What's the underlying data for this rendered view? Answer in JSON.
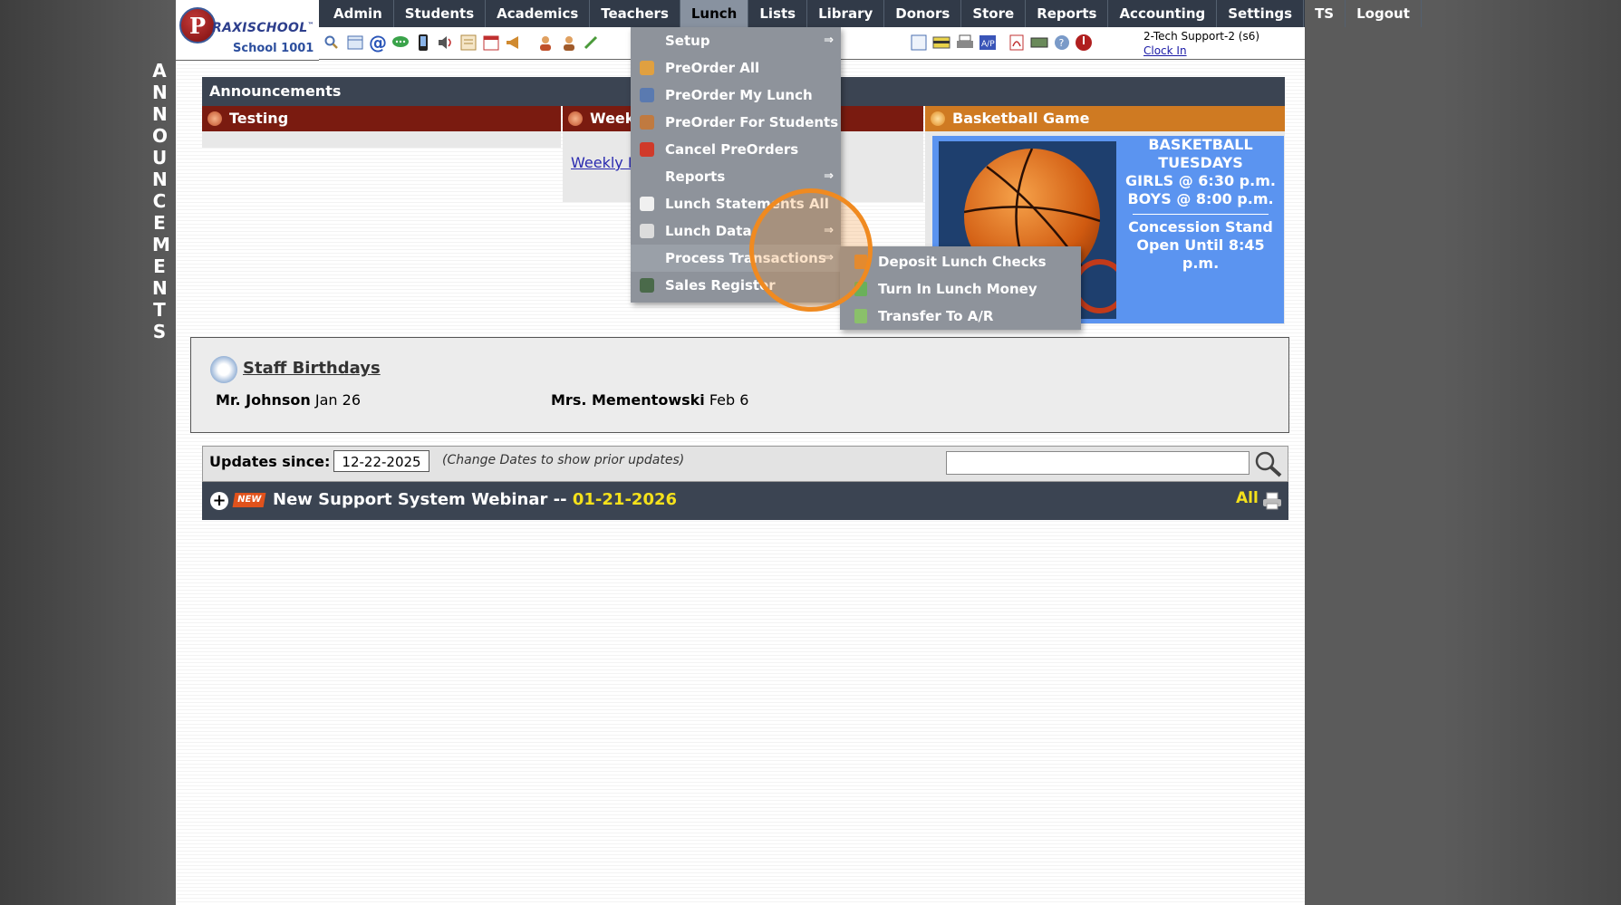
{
  "logo": {
    "initial": "P",
    "brand_line1": "RAXI",
    "brand_line2": "SCHOOL",
    "school": "School 1001",
    "tm": "™"
  },
  "nav": {
    "items": [
      "Admin",
      "Students",
      "Academics",
      "Teachers",
      "Lunch",
      "Lists",
      "Library",
      "Donors",
      "Store",
      "Reports",
      "Accounting",
      "Settings",
      "TS",
      "Logout"
    ],
    "active": "Lunch"
  },
  "user": {
    "name": "2-Tech Support-2 (s6)",
    "clock_in": "Clock In"
  },
  "side_word": [
    "A",
    "N",
    "N",
    "O",
    "U",
    "N",
    "C",
    "E",
    "M",
    "E",
    "N",
    "T",
    "S"
  ],
  "announcements": {
    "header": "Announcements",
    "col1_title": "Testing",
    "col2_title": "Week",
    "col2_link": "Weekly M",
    "col3_title": "Basketball Game",
    "basketball": {
      "line1": "BASKETBALL",
      "line2": "TUESDAYS",
      "line3": "GIRLS @ 6:30 p.m.",
      "line4": "BOYS  @ 8:00 p.m.",
      "line5": "Concession Stand",
      "line6": "Open Until 8:45 p.m."
    }
  },
  "birthdays": {
    "title": "Staff Birthdays",
    "entries": [
      {
        "name": "Mr. Johnson",
        "date": "Jan 26"
      },
      {
        "name": "Mrs. Mementowski",
        "date": "Feb 6"
      }
    ]
  },
  "updates": {
    "label": "Updates since:",
    "date": "12-22-2025",
    "hint": "(Change Dates to show prior updates)",
    "search_placeholder": ""
  },
  "news": {
    "badge": "NEW",
    "title": "New Support System Webinar -- ",
    "date": "01-21-2026",
    "all_label": "All"
  },
  "lunch_menu": {
    "items": [
      {
        "label": "Setup",
        "arrow": "⇒"
      },
      {
        "label": "PreOrder All",
        "arrow": ""
      },
      {
        "label": "PreOrder My Lunch",
        "arrow": ""
      },
      {
        "label": "PreOrder For Students",
        "arrow": ""
      },
      {
        "label": "Cancel PreOrders",
        "arrow": ""
      },
      {
        "label": "Reports",
        "arrow": "⇒"
      },
      {
        "label": "Lunch Statements All",
        "arrow": ""
      },
      {
        "label": "Lunch Data",
        "arrow": "⇒"
      },
      {
        "label": "Process Transactions",
        "arrow": "⇒"
      },
      {
        "label": "Sales Register",
        "arrow": ""
      }
    ],
    "submenu": [
      "Deposit Lunch Checks",
      "Turn In Lunch Money",
      "Transfer To A/R"
    ]
  },
  "colors": {
    "nav_bg": "#313a48",
    "accent_orange": "#f08a20",
    "news_date": "#f5e11b"
  }
}
